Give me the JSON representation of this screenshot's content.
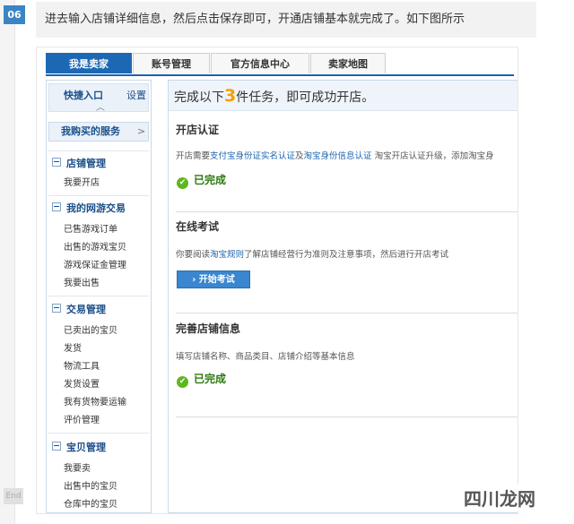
{
  "step": {
    "number": "06",
    "end_label": "End"
  },
  "instruction": "进去输入店铺详细信息，然后点击保存即可，开通店铺基本就完成了。如下图所示",
  "tabs": [
    "我是卖家",
    "账号管理",
    "官方信息中心",
    "卖家地图"
  ],
  "sidebar": {
    "quick_label": "快捷入口",
    "settings_label": "设置",
    "services_label": "我购买的服务",
    "groups": [
      {
        "title": "店铺管理",
        "items": [
          "我要开店"
        ]
      },
      {
        "title": "我的网游交易",
        "items": [
          "已售游戏订单",
          "出售的游戏宝贝",
          "游戏保证金管理",
          "我要出售"
        ]
      },
      {
        "title": "交易管理",
        "items": [
          "已卖出的宝贝",
          "发货",
          "物流工具",
          "发货设置",
          "我有货物要运输",
          "评价管理"
        ]
      },
      {
        "title": "宝贝管理",
        "items": [
          "我要卖",
          "出售中的宝贝",
          "仓库中的宝贝"
        ]
      }
    ]
  },
  "main": {
    "head_prefix": "完成以下",
    "head_count": "3",
    "head_suffix": "件任务，即可成功开店。",
    "sections": [
      {
        "title": "开店认证",
        "desc_a": "开店需要",
        "desc_link1": "支付宝身份证实名认证",
        "desc_b": "及",
        "desc_link2": "淘宝身份信息认证",
        "desc_c": " 淘宝开店认证升级，添加淘宝身",
        "status": "已完成"
      },
      {
        "title": "在线考试",
        "desc_a": "你要阅读",
        "desc_link1": "淘宝规则",
        "desc_b": "了解店铺经营行为准则及注意事项，然后进行开店考试",
        "button": "开始考试"
      },
      {
        "title": "完善店铺信息",
        "desc_a": "填写店铺名称、商品类目、店铺介绍等基本信息",
        "status": "已完成"
      }
    ]
  },
  "watermark": "四川龙网"
}
